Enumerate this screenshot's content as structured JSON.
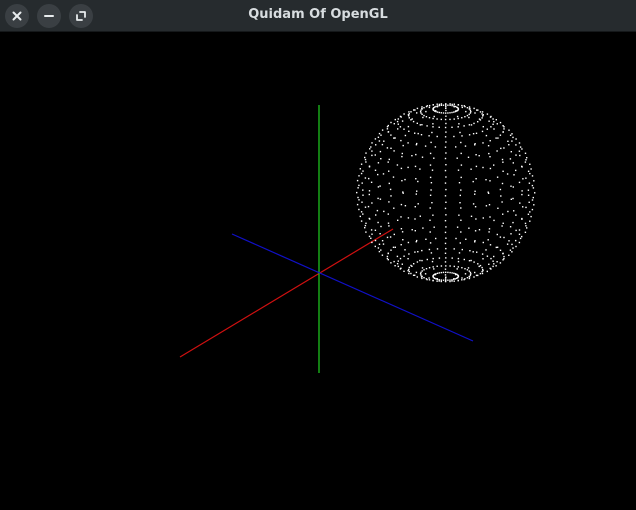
{
  "window": {
    "title": "Quidam Of OpenGL",
    "buttons": [
      {
        "name": "close",
        "icon": "close-icon"
      },
      {
        "name": "minimize",
        "icon": "minimize-icon"
      },
      {
        "name": "maximize",
        "icon": "maximize-icon"
      }
    ]
  },
  "scene": {
    "background": "#000000",
    "axes": [
      {
        "name": "x-axis",
        "color": "#d01010"
      },
      {
        "name": "y-axis",
        "color": "#20d020"
      },
      {
        "name": "z-axis",
        "color": "#1010c8"
      }
    ],
    "sphere": {
      "style": "point-cloud",
      "color": "#ffffff"
    }
  }
}
